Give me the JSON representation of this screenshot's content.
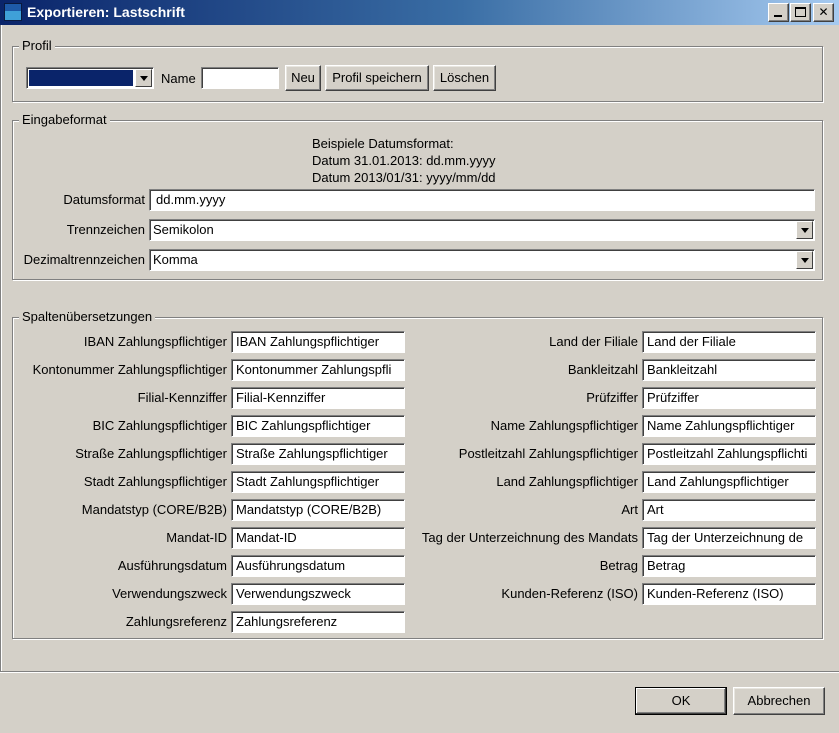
{
  "window": {
    "title": "Exportieren: Lastschrift",
    "minimize_icon": "minimize-icon",
    "maximize_icon": "maximize-icon",
    "close_icon": "close-icon",
    "close_glyph": "✕"
  },
  "profile": {
    "legend": "Profil",
    "selected": "",
    "name_label": "Name",
    "name_value": "",
    "new_label": "Neu",
    "save_label": "Profil speichern",
    "delete_label": "Löschen"
  },
  "input_format": {
    "legend": "Eingabeformat",
    "examples": [
      "Beispiele Datumsformat:",
      "Datum 31.01.2013: dd.mm.yyyy",
      "Datum 2013/01/31: yyyy/mm/dd"
    ],
    "date_format_label": "Datumsformat",
    "date_format_value": "dd.mm.yyyy",
    "separator_label": "Trennzeichen",
    "separator_value": "Semikolon",
    "decimal_label": "Dezimaltrennzeichen",
    "decimal_value": "Komma"
  },
  "columns": {
    "legend": "Spaltenübersetzungen",
    "left": [
      {
        "label": "IBAN Zahlungspflichtiger",
        "value": "IBAN Zahlungspflichtiger"
      },
      {
        "label": "Kontonummer Zahlungspflichtiger",
        "value": "Kontonummer Zahlungspfli"
      },
      {
        "label": "Filial-Kennziffer",
        "value": "Filial-Kennziffer"
      },
      {
        "label": "BIC Zahlungspflichtiger",
        "value": "BIC Zahlungspflichtiger"
      },
      {
        "label": "Straße Zahlungspflichtiger",
        "value": "Straße Zahlungspflichtiger"
      },
      {
        "label": "Stadt Zahlungspflichtiger",
        "value": "Stadt Zahlungspflichtiger"
      },
      {
        "label": "Mandatstyp (CORE/B2B)",
        "value": "Mandatstyp (CORE/B2B)"
      },
      {
        "label": "Mandat-ID",
        "value": "Mandat-ID"
      },
      {
        "label": "Ausführungsdatum",
        "value": "Ausführungsdatum"
      },
      {
        "label": "Verwendungszweck",
        "value": "Verwendungszweck"
      },
      {
        "label": "Zahlungsreferenz",
        "value": "Zahlungsreferenz"
      }
    ],
    "right": [
      {
        "label": "Land der Filiale",
        "value": "Land der Filiale"
      },
      {
        "label": "Bankleitzahl",
        "value": "Bankleitzahl"
      },
      {
        "label": "Prüfziffer",
        "value": "Prüfziffer"
      },
      {
        "label": "Name Zahlungspflichtiger",
        "value": "Name Zahlungspflichtiger"
      },
      {
        "label": "Postleitzahl Zahlungspflichtiger",
        "value": "Postleitzahl Zahlungspflichti"
      },
      {
        "label": "Land Zahlungspflichtiger",
        "value": "Land Zahlungspflichtiger"
      },
      {
        "label": "Art",
        "value": "Art"
      },
      {
        "label": "Tag der Unterzeichnung des Mandats",
        "value": "Tag der Unterzeichnung de"
      },
      {
        "label": "Betrag",
        "value": "Betrag"
      },
      {
        "label": "Kunden-Referenz (ISO)",
        "value": "Kunden-Referenz (ISO)"
      }
    ]
  },
  "footer": {
    "ok_label": "OK",
    "cancel_label": "Abbrechen"
  },
  "colors": {
    "title_gradient_start": "#0a246a",
    "title_gradient_end": "#a6caf0",
    "dialog_bg": "#d4d0c8",
    "profile_selected": "#0a246a"
  }
}
